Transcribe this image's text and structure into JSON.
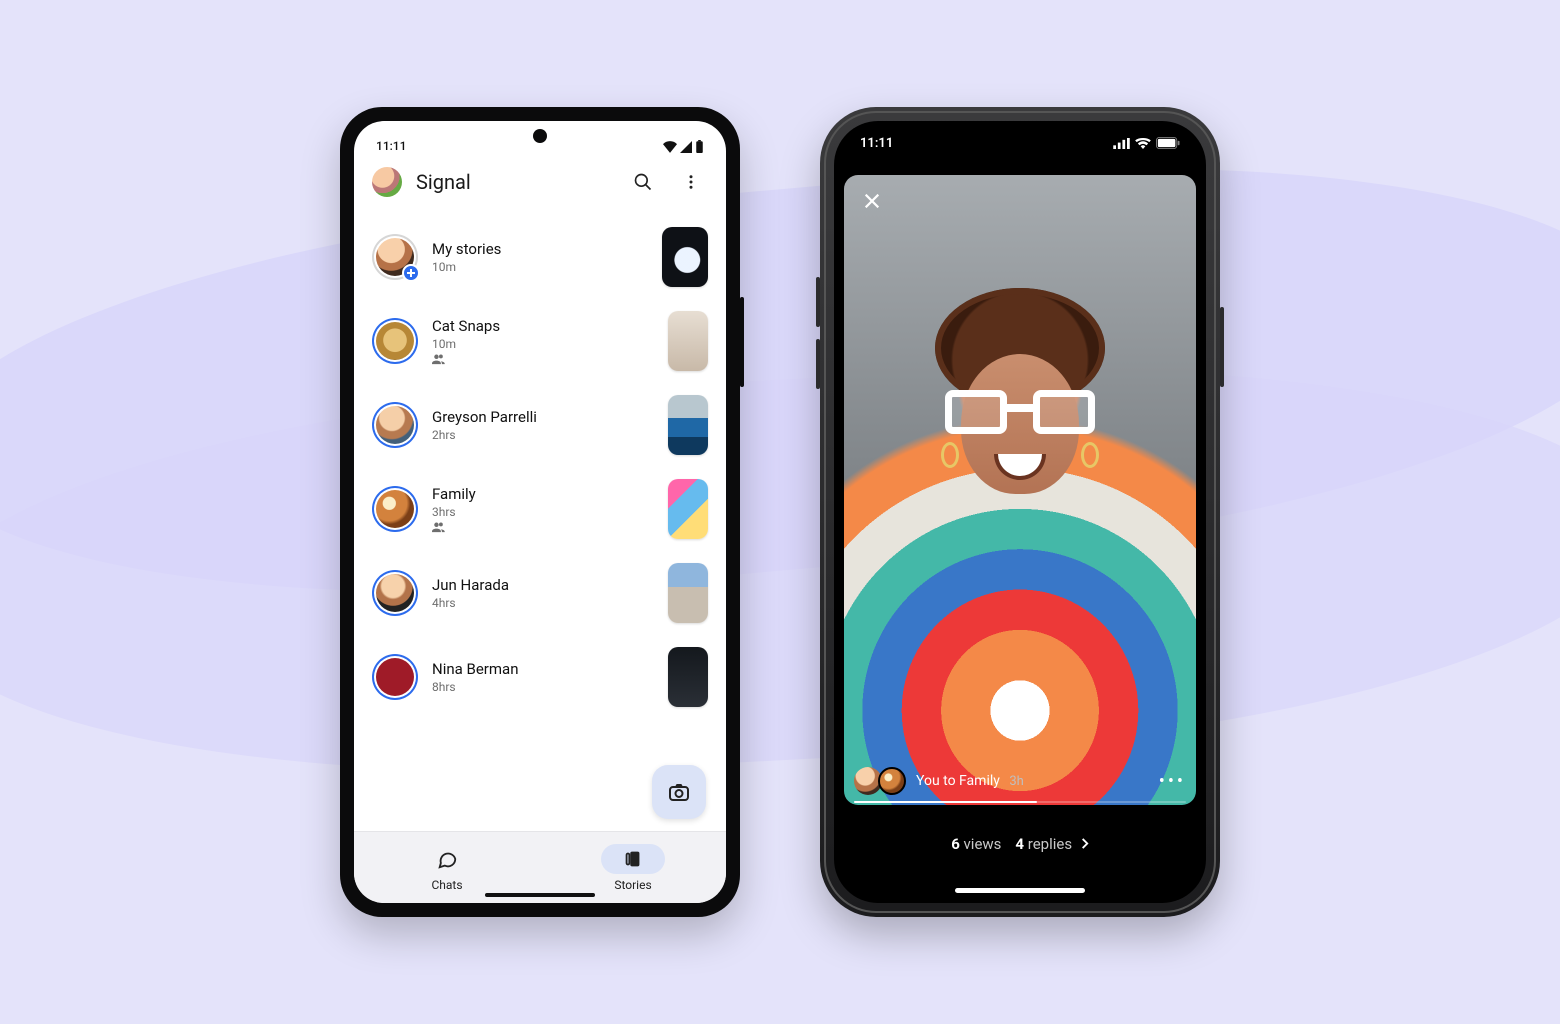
{
  "android": {
    "status_time": "11:11",
    "app_title": "Signal",
    "my_stories": {
      "title": "My stories",
      "time": "10m"
    },
    "stories": [
      {
        "name": "Cat Snaps",
        "time": "10m",
        "group": true,
        "avatar": "a-cat",
        "thumb": "t-door"
      },
      {
        "name": "Greyson Parrelli",
        "time": "2hrs",
        "group": false,
        "avatar": "a-grey",
        "thumb": "t-water"
      },
      {
        "name": "Family",
        "time": "3hrs",
        "group": true,
        "avatar": "a-fam",
        "thumb": "t-selfie"
      },
      {
        "name": "Jun Harada",
        "time": "4hrs",
        "group": false,
        "avatar": "a-jun",
        "thumb": "t-rock"
      },
      {
        "name": "Nina Berman",
        "time": "8hrs",
        "group": false,
        "avatar": "a-nina",
        "thumb": "t-night"
      }
    ],
    "tabs": {
      "chats": "Chats",
      "stories": "Stories"
    }
  },
  "iphone": {
    "status_time": "11:11",
    "caption_main": "You to Family",
    "caption_time": "3h",
    "views_count": "6",
    "views_label": "views",
    "replies_count": "4",
    "replies_label": "replies"
  }
}
